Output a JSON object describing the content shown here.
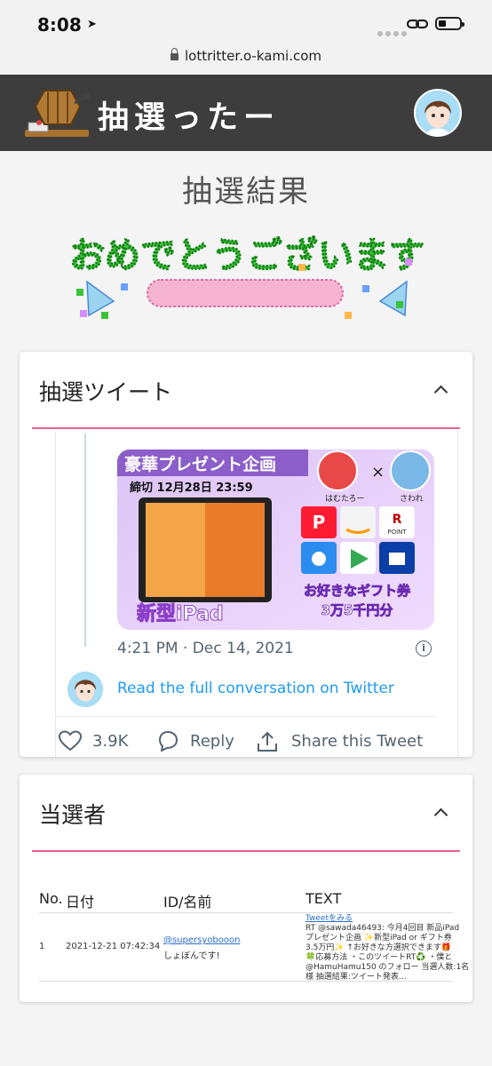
{
  "status_bar": {
    "time": "8:08"
  },
  "browser": {
    "url": "lottritter.o-kami.com"
  },
  "header": {
    "site_title": "抽選ったー"
  },
  "page": {
    "title": "抽選結果",
    "banner_text": "おめでとうございます"
  },
  "tweet_card": {
    "title": "抽選ツイート",
    "media": {
      "top_left_text": "豪華プレゼント企画",
      "deadline": "締切 12月28日 23:59",
      "product": "新型iPad",
      "gift_line1": "お好きなギフト券",
      "gift_line2": "3万5千円分",
      "name1": "はむたろー",
      "name2": "さわれ",
      "rpoint": "POINT"
    },
    "timestamp": "4:21 PM · Dec 14, 2021",
    "read_more": "Read the full conversation on Twitter",
    "likes": "3.9K",
    "reply": "Reply",
    "share": "Share this Tweet"
  },
  "winners_card": {
    "title": "当選者",
    "columns": [
      "No.",
      "日付",
      "ID/名前",
      "TEXT"
    ],
    "rows": [
      {
        "no": "1",
        "date": "2021-12-21 07:42:34",
        "id": "@supersyobooon",
        "name": "しょぼんです!",
        "link": "Tweetをみる",
        "text_lines": [
          "RT @sawada46493: 今月4回目 新品iPad",
          "プレゼント企画 ✨新型iPad or ギフト券",
          "3.5万円✨ ↑お好きな方選択できます🎁",
          "🍀応募方法 ・このツイートRT♻️ ・僕と",
          "@HamuHamu150 のフォロー 当選人数:1名",
          "様 抽選結果:ツイート発表…"
        ]
      }
    ]
  },
  "colors": {
    "accent": "#e8608f",
    "header_bg": "#3d3d3d",
    "link": "#1d9bf0"
  }
}
